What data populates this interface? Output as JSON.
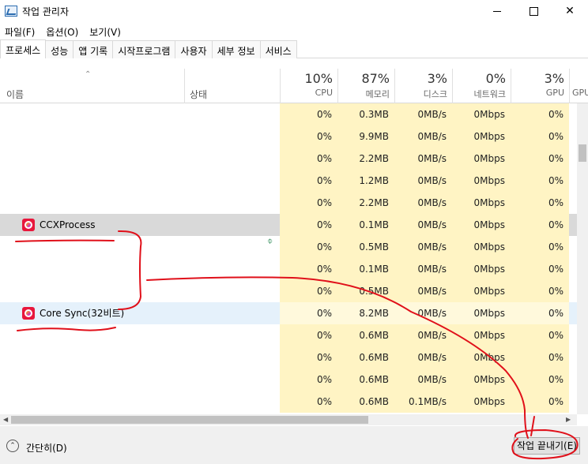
{
  "window": {
    "title": "작업 관리자"
  },
  "menu": [
    "파일(F)",
    "옵션(O)",
    "보기(V)"
  ],
  "tabs": [
    "프로세스",
    "성능",
    "앱 기록",
    "시작프로그램",
    "사용자",
    "세부 정보",
    "서비스"
  ],
  "header": {
    "name_label": "이름",
    "status_label": "상태",
    "columns": [
      {
        "pct": "10%",
        "label": "CPU"
      },
      {
        "pct": "87%",
        "label": "메모리"
      },
      {
        "pct": "3%",
        "label": "디스크"
      },
      {
        "pct": "0%",
        "label": "네트워크"
      },
      {
        "pct": "3%",
        "label": "GPU"
      }
    ],
    "extra_label": "GPU"
  },
  "rows": [
    {
      "name": "",
      "cpu": "0%",
      "mem": "0.3MB",
      "disk": "0MB/s",
      "net": "0Mbps",
      "gpu": "0%"
    },
    {
      "name": "",
      "cpu": "0%",
      "mem": "9.9MB",
      "disk": "0MB/s",
      "net": "0Mbps",
      "gpu": "0%"
    },
    {
      "name": "",
      "cpu": "0%",
      "mem": "2.2MB",
      "disk": "0MB/s",
      "net": "0Mbps",
      "gpu": "0%"
    },
    {
      "name": "",
      "cpu": "0%",
      "mem": "1.2MB",
      "disk": "0MB/s",
      "net": "0Mbps",
      "gpu": "0%"
    },
    {
      "name": "",
      "cpu": "0%",
      "mem": "2.2MB",
      "disk": "0MB/s",
      "net": "0Mbps",
      "gpu": "0%"
    },
    {
      "name": "CCXProcess",
      "cpu": "0%",
      "mem": "0.1MB",
      "disk": "0MB/s",
      "net": "0Mbps",
      "gpu": "0%"
    },
    {
      "name": "",
      "cpu": "0%",
      "mem": "0.5MB",
      "disk": "0MB/s",
      "net": "0Mbps",
      "gpu": "0%"
    },
    {
      "name": "",
      "cpu": "0%",
      "mem": "0.1MB",
      "disk": "0MB/s",
      "net": "0Mbps",
      "gpu": "0%"
    },
    {
      "name": "",
      "cpu": "0%",
      "mem": "0.5MB",
      "disk": "0MB/s",
      "net": "0Mbps",
      "gpu": "0%"
    },
    {
      "name": "Core Sync(32비트)",
      "cpu": "0%",
      "mem": "8.2MB",
      "disk": "0MB/s",
      "net": "0Mbps",
      "gpu": "0%"
    },
    {
      "name": "",
      "cpu": "0%",
      "mem": "0.6MB",
      "disk": "0MB/s",
      "net": "0Mbps",
      "gpu": "0%"
    },
    {
      "name": "",
      "cpu": "0%",
      "mem": "0.6MB",
      "disk": "0MB/s",
      "net": "0Mbps",
      "gpu": "0%"
    },
    {
      "name": "",
      "cpu": "0%",
      "mem": "0.6MB",
      "disk": "0MB/s",
      "net": "0Mbps",
      "gpu": "0%"
    },
    {
      "name": "",
      "cpu": "0%",
      "mem": "0.6MB",
      "disk": "0.1MB/s",
      "net": "0Mbps",
      "gpu": "0%"
    }
  ],
  "footer": {
    "collapse_label": "간단히(D)",
    "end_task_label": "작업 끝내기(E)"
  },
  "colors": {
    "accent_highlight": "#fff4c4",
    "annotation": "#e0101a",
    "selected_row": "#d9d9d9"
  },
  "icons": {
    "app": "task-manager-icon",
    "process": "creative-cloud-icon",
    "efficiency": "leaf-icon"
  }
}
